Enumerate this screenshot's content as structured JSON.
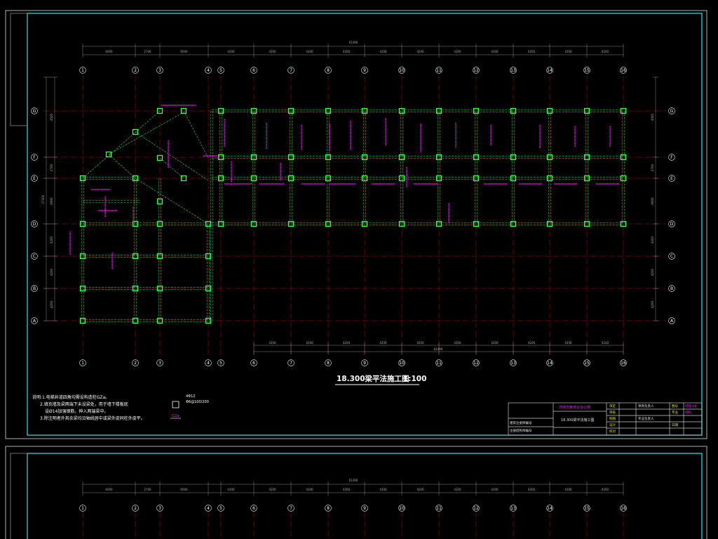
{
  "drawing_title": "18.300梁平法施工图",
  "drawing_scale": "1:100",
  "axes": {
    "columns": [
      "1",
      "2",
      "3",
      "4",
      "5",
      "6",
      "7",
      "8",
      "9",
      "10",
      "11",
      "12",
      "13",
      "14",
      "15",
      "16"
    ],
    "rows": [
      "G",
      "F",
      "E",
      "D",
      "C",
      "B",
      "A"
    ],
    "top_dims": [
      "6000",
      "2700",
      "6000",
      "4200",
      "4200",
      "4200",
      "4200",
      "4200",
      "4200",
      "4200",
      "4200",
      "4200",
      "4200",
      "4200"
    ],
    "top_total": "61490",
    "bottom_dims": [
      "4200",
      "4200",
      "4200",
      "4200",
      "4200",
      "4200",
      "4200",
      "4200",
      "4200",
      "4200",
      "4200"
    ],
    "bottom_total": "61490",
    "left_dims": [
      "4500",
      "2700",
      "6900",
      "4200",
      "4200",
      "4200"
    ],
    "left_total": "27300"
  },
  "notes": [
    "说明:1.电梯井道四角均需设构造柱GZa。",
    "2.填充墙及梁两端下未设梁处，用于墙下楼板底",
    "设Ø14加强钢筋，伸入两端梁中。",
    "3.除注明者外其余梁均沿轴线居中或梁外皮同柱外皮平。"
  ],
  "gz_detail": {
    "bars": "4Φ12",
    "stirrups": "Φ6@100/200",
    "label": "GZa"
  },
  "title_block": {
    "company": "济南市某综合办公楼",
    "drawing_name": "18.300梁平法施工图",
    "roles": [
      "审定",
      "审核",
      "设计",
      "校对",
      "制图"
    ],
    "role_extra": [
      "专业负责人",
      "项目负责人",
      "专业",
      "日期",
      "图号",
      "结施-08",
      "结构"
    ],
    "stamp_left": [
      "建筑注册师编号",
      "注册结构师编号"
    ]
  },
  "colors": {
    "frame": "#00e5e5",
    "axis_line": "#c8001e",
    "beam": "#22d64a",
    "column": "#3dff5a",
    "dim": "#a8a8a8",
    "annotation": "#e020e0",
    "text": "#ffffff"
  }
}
